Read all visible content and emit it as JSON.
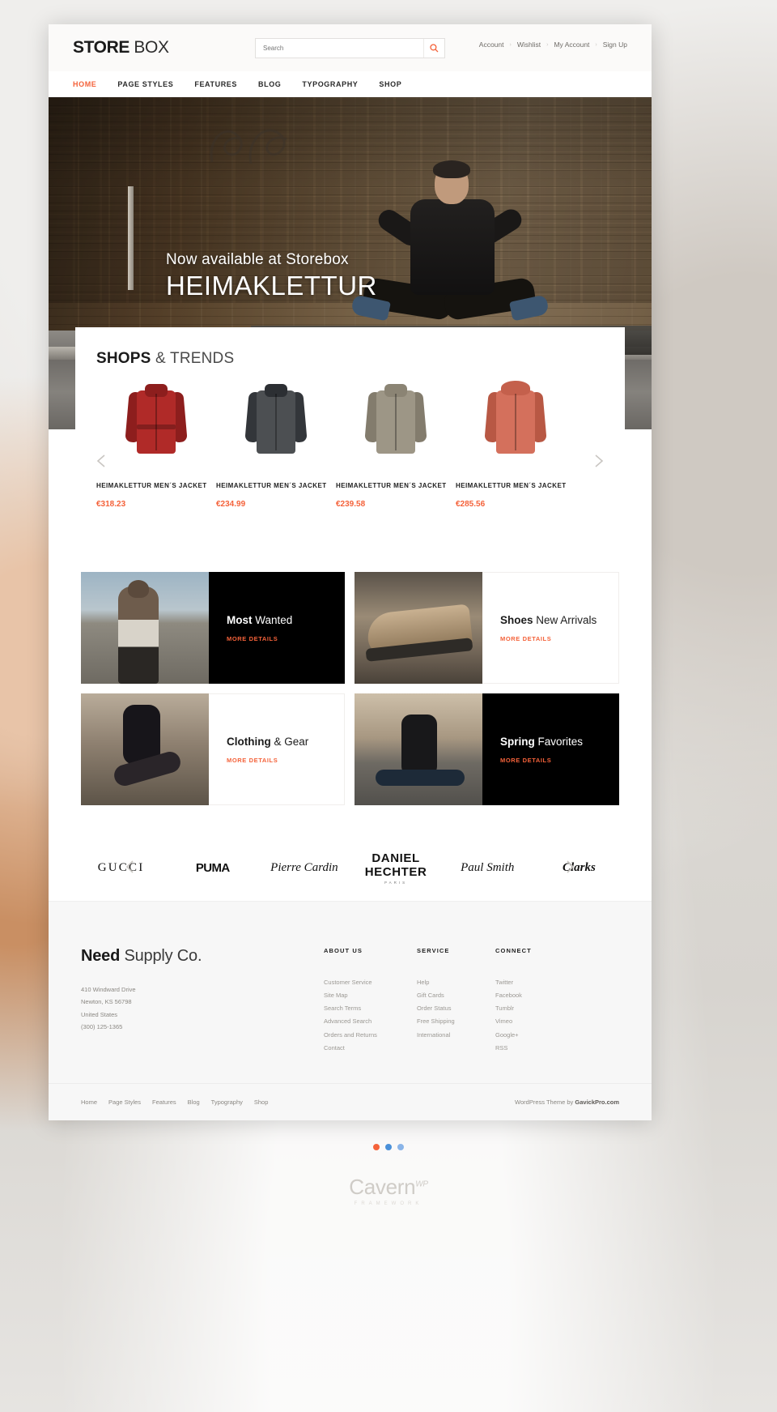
{
  "theme": {
    "accent": "#f4623a",
    "dark": "#000000",
    "page_bg": "#ffffff"
  },
  "header": {
    "logo_bold": "STORE",
    "logo_light": " BOX",
    "search": {
      "placeholder": "Search",
      "value": "",
      "icon": "search-icon"
    },
    "account_links": [
      "Account",
      "Wishlist",
      "My Account",
      "Sign Up"
    ],
    "separator": "›",
    "nav": [
      {
        "label": "HOME",
        "active": true
      },
      {
        "label": "PAGE STYLES",
        "active": false
      },
      {
        "label": "FEATURES",
        "active": false
      },
      {
        "label": "BLOG",
        "active": false
      },
      {
        "label": "TYPOGRAPHY",
        "active": false
      },
      {
        "label": "SHOP",
        "active": false
      }
    ]
  },
  "hero": {
    "subtitle": "Now available at Storebox",
    "title": "HEIMAKLETTUR"
  },
  "trends": {
    "title_bold": "SHOPS ",
    "title_light": "& TRENDS",
    "prev_icon": "chevron-left-icon",
    "next_icon": "chevron-right-icon",
    "products": [
      {
        "name": "HEIMAKLETTUR MEN´S JACKET",
        "price": "€318.23",
        "color": "#b02a28",
        "color2": "#8d1e1d"
      },
      {
        "name": "HEIMAKLETTUR MEN´S JACKET",
        "price": "€234.99",
        "color": "#4c4f52",
        "color2": "#33363a"
      },
      {
        "name": "HEIMAKLETTUR MEN´S JACKET",
        "price": "€239.58",
        "color": "#9d9686",
        "color2": "#837c6d"
      },
      {
        "name": "HEIMAKLETTUR MEN´S JACKET",
        "price": "€285.56",
        "color": "#d4705c",
        "color2": "#b85844"
      }
    ]
  },
  "promos": [
    {
      "title_bold": "Most",
      "title_light": " Wanted",
      "cta": "MORE DETAILS",
      "panel": "dark",
      "image_side": "left",
      "image": "im-woman-dock"
    },
    {
      "title_bold": "Shoes",
      "title_light": " New Arrivals",
      "cta": "MORE DETAILS",
      "panel": "light",
      "image_side": "left",
      "image": "im-boot"
    },
    {
      "title_bold": "Clothing",
      "title_light": " & Gear",
      "cta": "MORE DETAILS",
      "panel": "light",
      "image_side": "left",
      "image": "im-woman-sit"
    },
    {
      "title_bold": "Spring",
      "title_light": " Favorites",
      "cta": "MORE DETAILS",
      "panel": "dark",
      "image_side": "left",
      "image": "im-spring"
    }
  ],
  "brands": {
    "prev_icon": "chevron-left-icon",
    "next_icon": "chevron-right-icon",
    "items": [
      {
        "name": "GUCCI",
        "sub": ""
      },
      {
        "name": "PUMA",
        "sub": ""
      },
      {
        "name": "Pierre Cardin",
        "sub": ""
      },
      {
        "name": "DANIEL HECHTER",
        "sub": "PARIS"
      },
      {
        "name": "Paul Smith",
        "sub": ""
      },
      {
        "name": "Clarks",
        "sub": ""
      }
    ]
  },
  "footer": {
    "brand_bold": "Need",
    "brand_light": " Supply Co.",
    "address": [
      "410 Windward Drive",
      "Newton, KS 56798",
      "United States",
      "(300) 125-1365"
    ],
    "columns": [
      {
        "heading": "ABOUT US",
        "items": [
          "Customer Service",
          "Site Map",
          "Search Terms",
          "Advanced Search",
          "Orders and Returns",
          "Contact"
        ]
      },
      {
        "heading": "SERVICE",
        "items": [
          "Help",
          "Gift Cards",
          "Order Status",
          "Free Shipping",
          "International"
        ]
      },
      {
        "heading": "CONNECT",
        "items": [
          "Twitter",
          "Facebook",
          "Tumblr",
          "Vimeo",
          "Google+",
          "RSS"
        ]
      }
    ],
    "bottom_links": [
      "Home",
      "Page Styles",
      "Features",
      "Blog",
      "Typography",
      "Shop"
    ],
    "copyright_prefix": "WordPress Theme by ",
    "copyright_brand": "GavickPro.com"
  },
  "carousel_dots": [
    {
      "color": "#f4623a",
      "active": true
    },
    {
      "color": "#4a90d9",
      "active": false
    },
    {
      "color": "#8ab4e8",
      "active": false
    }
  ],
  "watermark": {
    "name": "Cavern",
    "sup": "WP",
    "tagline": "FRAMEWORK"
  }
}
